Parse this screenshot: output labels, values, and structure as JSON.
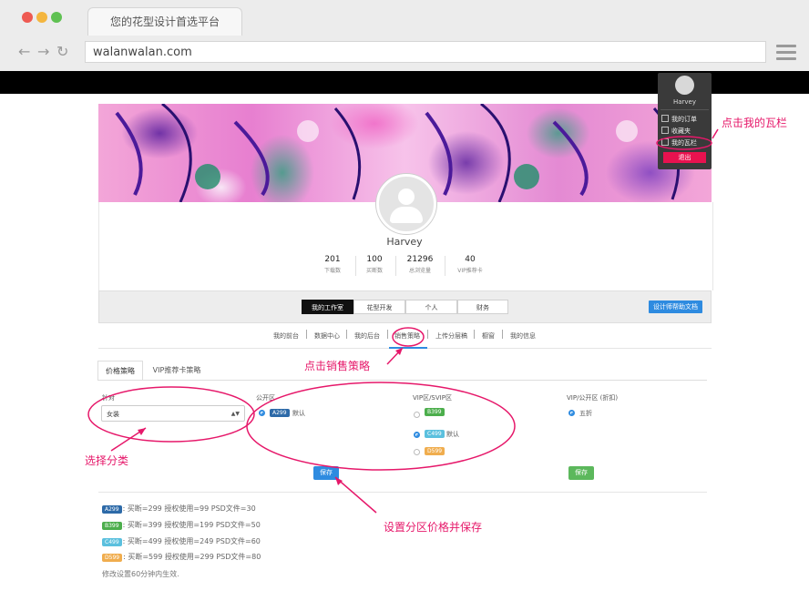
{
  "browser": {
    "tab_title": "您的花型设计首选平台",
    "url": "walanwalan.com",
    "traffic_lights": [
      "#ee5a52",
      "#f4b63f",
      "#5fc152"
    ]
  },
  "user_menu": {
    "name": "Harvey",
    "items": [
      "我的订单",
      "收藏夹",
      "我的瓦栏"
    ],
    "logout": "退出"
  },
  "profile": {
    "name": "Harvey",
    "stats": [
      {
        "value": "201",
        "label": "下载数"
      },
      {
        "value": "100",
        "label": "买断数"
      },
      {
        "value": "21296",
        "label": "总浏览量"
      },
      {
        "value": "40",
        "label": "VIP推荐卡"
      }
    ]
  },
  "workspace_tabs": [
    "我的工作室",
    "花型开发",
    "个人",
    "财务"
  ],
  "help_button": "设计师帮助文档",
  "sub_nav": [
    "我的前台",
    "数据中心",
    "我的后台",
    "销售策略",
    "上传分层稿",
    "橱窗",
    "我的信息"
  ],
  "strategy_tabs": [
    "价格策略",
    "VIP推荐卡策略"
  ],
  "form": {
    "category_label": "针对",
    "category_value": "女装",
    "public_label": "公开区",
    "vip_label": "VIP区/SVIP区",
    "vip_public_label": "VIP/公开区 (折扣)",
    "default_text": "默认",
    "discount_text": "五折",
    "save_label": "保存"
  },
  "badges": {
    "A299": {
      "text": "A299",
      "color": "#2d6aa8"
    },
    "B399": {
      "text": "B399",
      "color": "#4cae4c"
    },
    "C499": {
      "text": "C499",
      "color": "#5bc0de"
    },
    "D599": {
      "text": "D599",
      "color": "#f0ad4e"
    }
  },
  "legend": [
    {
      "badge": "A299",
      "text": ": 买断=299 授权使用=99 PSD文件=30"
    },
    {
      "badge": "B399",
      "text": ": 买断=399 授权使用=199 PSD文件=50"
    },
    {
      "badge": "C499",
      "text": ": 买断=499 授权使用=249 PSD文件=60"
    },
    {
      "badge": "D599",
      "text": ": 买断=599 授权使用=299 PSD文件=80"
    }
  ],
  "note": "修改设置60分钟内生效.",
  "annotations": {
    "my_walan": "点击我的瓦栏",
    "sales_strategy": "点击销售策略",
    "choose_category": "选择分类",
    "set_price": "设置分区价格并保存"
  },
  "accent_color": "#e6186a"
}
